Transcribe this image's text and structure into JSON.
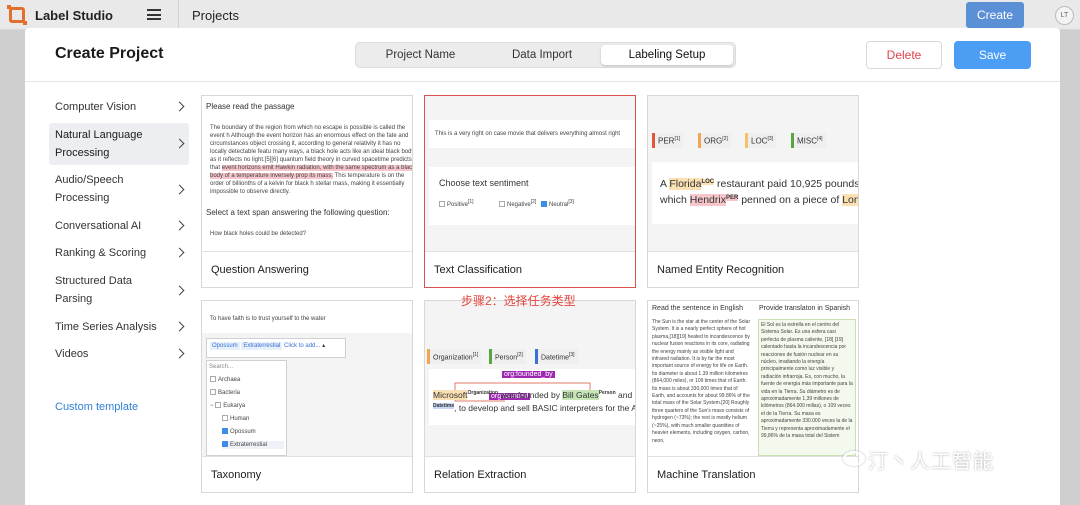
{
  "app": {
    "name": "Label Studio",
    "breadcrumb": "Projects",
    "create_label": "Create",
    "avatar_initials": "LT",
    "accent": "#5b8fd6"
  },
  "modal": {
    "title": "Create Project",
    "tabs": [
      "Project Name",
      "Data Import",
      "Labeling Setup"
    ],
    "active_tab": "Labeling Setup",
    "delete_label": "Delete",
    "save_label": "Save"
  },
  "sidebar": {
    "items": [
      {
        "label": "Computer Vision",
        "active": false
      },
      {
        "label": "Natural Language Processing",
        "active": true
      },
      {
        "label": "Audio/Speech Processing",
        "active": false
      },
      {
        "label": "Conversational AI",
        "active": false
      },
      {
        "label": "Ranking & Scoring",
        "active": false
      },
      {
        "label": "Structured Data Parsing",
        "active": false
      },
      {
        "label": "Time Series Analysis",
        "active": false
      },
      {
        "label": "Videos",
        "active": false
      }
    ],
    "custom_template": "Custom template"
  },
  "templates": [
    {
      "label": "Question Answering",
      "selected": false
    },
    {
      "label": "Text Classification",
      "selected": true
    },
    {
      "label": "Named Entity Recognition",
      "selected": false
    },
    {
      "label": "Taxonomy",
      "selected": false
    },
    {
      "label": "Relation Extraction",
      "selected": false
    },
    {
      "label": "Machine Translation",
      "selected": false
    }
  ],
  "previews": {
    "qa": {
      "heading": "Please read the passage",
      "passage": "The boundary of the region from which no escape is possible is called the event h Although the event horizon has an enormous effect on the fate and circumstances object crossing it, according to general relativity it has no locally detectable featu many ways, a black hole acts like an ideal black body, as it reflects no light.[5][6] quantum field theory in curved spacetime predicts that",
      "highlight": "event horizons emit Hawkin radiation, with the same spectrum as a black body of a temperature inversely prop its mass.",
      "passage_end": "This temperature is on the order of billionths of a kelvin for black h stellar mass, making it essentially impossible to observe directly.",
      "prompt": "Select a text span answering the following question:",
      "question": "How black holes could be detected?"
    },
    "tc": {
      "text": "This is a very right on case movie that delivers everything almost right",
      "prompt": "Choose text sentiment",
      "options": [
        "Positive",
        "Negative",
        "Neutral"
      ],
      "option_keys": [
        "[1]",
        "[2]",
        "[3]"
      ],
      "checked": "Neutral"
    },
    "ner": {
      "tags": [
        "PER",
        "ORG",
        "LOC",
        "MISC"
      ],
      "tag_keys": [
        "[1]",
        "[2]",
        "[3]",
        "[4]"
      ],
      "tag_colors": [
        "#e4563a",
        "#f5a455",
        "#f5c26b",
        "#58a63c"
      ],
      "line1_pre": "A ",
      "entity1": "Florida",
      "entity1_tag": "LOC",
      "line1_post": " restaurant paid 10,925 pounds",
      "line2_pre": "which ",
      "entity2": "Hendrix",
      "entity2_tag": "PER",
      "line2_post": " penned on a piece of ",
      "line2_tail": "Lon"
    },
    "tax": {
      "text": "To have faith is to trust yourself to the water",
      "selected": [
        "Opossum",
        "Extraterrestial"
      ],
      "add_placeholder": "Click to add...",
      "search_placeholder": "Search...",
      "tree": [
        {
          "label": "Archaea",
          "checked": false,
          "indent": 0
        },
        {
          "label": "Bacteria",
          "checked": false,
          "indent": 0
        },
        {
          "label": "Eukarya",
          "checked": false,
          "indent": 0,
          "expander": "−"
        },
        {
          "label": "Human",
          "checked": false,
          "indent": 1
        },
        {
          "label": "Opossum",
          "checked": true,
          "indent": 1
        },
        {
          "label": "Extraterrestial",
          "checked": true,
          "indent": 1
        }
      ]
    },
    "re": {
      "tags": [
        "Organization",
        "Person",
        "Datetime"
      ],
      "tag_keys": [
        "[1]",
        "[2]",
        "[3]"
      ],
      "tag_colors": [
        "#f5a455",
        "#58a63c",
        "#3a6fd6"
      ],
      "rel1": "org:founded_by",
      "rel2": "org:founded",
      "t1": "Microsoft",
      "t1_tag": "Organization",
      "t2": " was founded by ",
      "t3": "Bill Gates",
      "t3_tag": "Person",
      "t4": " and P",
      "t5_tag": "Datetime",
      "t6": ", to develop and sell BASIC interpreters for the Al"
    },
    "mt": {
      "left_title": "Read the sentence in English",
      "right_title": "Provide translaton in Spanish",
      "left_text": "The Sun is the star at the center of the Solar System. It is a nearly perfect sphere of hot plasma,[18][19] heated to incandescence by nuclear fusion reactions in its core, radiating the energy mainly as visible light and infrared radiation. It is by far the most important source of energy for life on Earth. Its diameter is about 1.39 million kilometres (864,000 miles), or 109 times that of Earth. Its mass is about 330,000 times that of Earth, and accounts for about 99.86% of the total mass of the Solar System.[20] Roughly three quarters of the Sun's mass consists of hydrogen (~73%); the rest is mostly helium (~25%), with much smaller quantities of heavier elements, including oxygen, carbon, neon,",
      "right_text": "El Sol es la estrella en el centro del Sistema Solar. Es una esfera casi perfecta de plasma caliente, [18] [19] calentado hasta la incandescencia por reacciones de fusión nuclear en su núcleo, irradiando la energía principalmente como luz visible y radiación infrarroja. Es, con mucho, la fuente de energía más importante para la vida en la Tierra. Su diámetro es de aproximadamente 1,39 millones de kilómetros (864.000 millas), o 109 veces el de la Tierra. Su masa es aproximadamente 330.000 veces la de la Tierra y representa aproximadamente el 99,86% de la masa total del Sistem"
    }
  },
  "annotation": "步骤2：选择任务类型",
  "watermark": "汀丶人工智能"
}
